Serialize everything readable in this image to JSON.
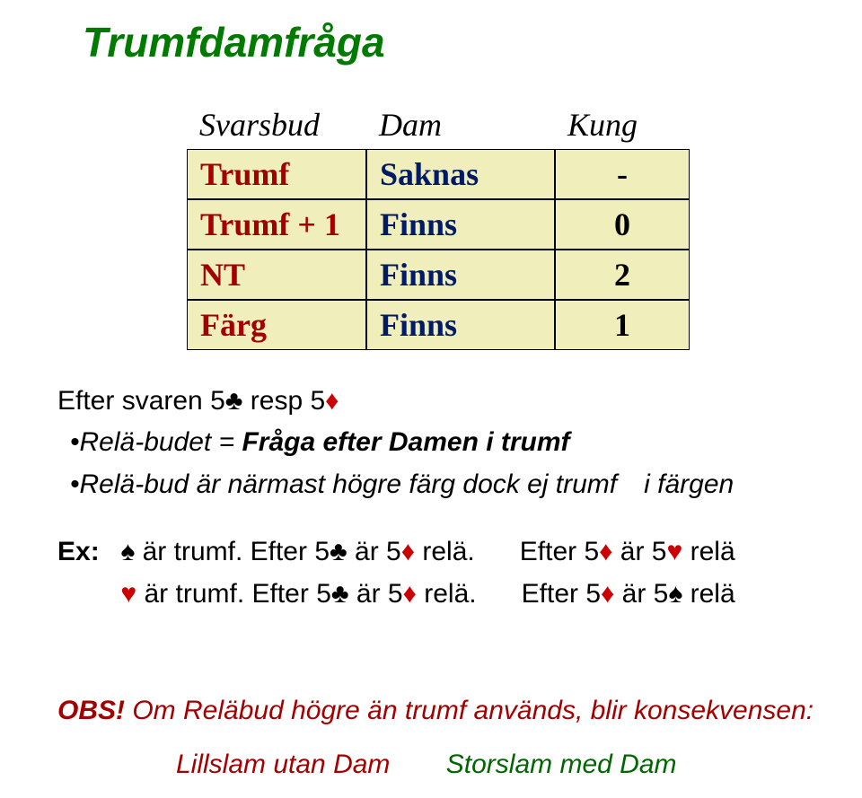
{
  "title": "Trumfdamfråga",
  "table": {
    "headers": [
      "Svarsbud",
      "Dam",
      "Kung"
    ],
    "rows": [
      {
        "c1": "Trumf",
        "c2": "Saknas",
        "c3": "-"
      },
      {
        "c1": "Trumf + 1",
        "c2": "Finns",
        "c3": "0"
      },
      {
        "c1": "NT",
        "c2": "Finns",
        "c3": "2"
      },
      {
        "c1": "Färg",
        "c2": "Finns",
        "c3": "1"
      }
    ]
  },
  "efter_prefix": "Efter svaren 5",
  "efter_mid": " resp 5",
  "bullet1_label": "•Relä-budet  = ",
  "bullet1_bold": "Fråga efter Damen i trumf",
  "bullet2": "•Relä-bud är närmast högre färg dock ej trumf",
  "bullet2_note": "i färgen",
  "ex_label": "Ex:",
  "ex_line1_a": " är trumf.  Efter 5",
  "ex_line1_b": " är 5",
  "ex_line1_c": " relä.",
  "ex_line1_d": "Efter 5",
  "ex_line1_e": " är 5",
  "ex_line1_f": " relä",
  "ex_line2_a": " är trumf.  Efter 5",
  "ex_line2_b": " är 5",
  "ex_line2_c": " relä.",
  "ex_line2_d": "Efter 5",
  "ex_line2_e": " är 5",
  "ex_line2_f": " relä",
  "obs_bold": "OBS! ",
  "obs_rest": "Om Reläbud högre än trumf används, blir konsekvensen:",
  "lill": "Lillslam utan Dam",
  "stor": "Storslam med Dam",
  "suits": {
    "club": "♣",
    "diamond": "♦",
    "heart": "♥",
    "spade": "♠"
  }
}
